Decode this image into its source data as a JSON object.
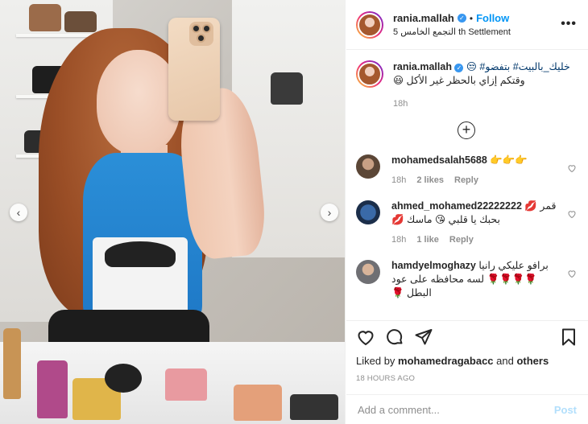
{
  "post": {
    "username": "rania.mallah",
    "follow_label": "Follow",
    "dot": "•",
    "location": "5 التجمع الخامس th Settlement",
    "more_label": "•••"
  },
  "caption": {
    "username": "rania.mallah",
    "line1": "خليك_بالبيت# بتفضو# 😒",
    "line2": "وقتكم إزاي بالحظر غير الأكل 😃",
    "time": "18h"
  },
  "comments": [
    {
      "username": "mohamedsalah5688",
      "text": "👉👉👉",
      "time": "18h",
      "likes": "2 likes",
      "reply": "Reply"
    },
    {
      "username": "ahmed_mohamed22222222",
      "text": "قمر 💋 بحبك يا قلبي 😘 ماسك 💋",
      "time": "18h",
      "likes": "1 like",
      "reply": "Reply"
    },
    {
      "username": "hamdyelmoghazy",
      "text": "برافو عليكي رانيا 🌹🌹🌹🌹 لسه محافظه على عود البطل 🌹",
      "time": "",
      "likes": "",
      "reply": ""
    }
  ],
  "likes": {
    "prefix": "Liked by ",
    "user": "mohamedragabacc",
    "middle": " and ",
    "others": "others"
  },
  "timestamp": "18 hours ago",
  "add_comment": {
    "placeholder": "Add a comment...",
    "post_label": "Post"
  },
  "carousel": {
    "prev": "‹",
    "next": "›"
  },
  "colors": {
    "accent": "#0095f6",
    "verified": "#3897f0",
    "muted": "#8e8e8e",
    "post_disabled": "#b2dffc"
  }
}
